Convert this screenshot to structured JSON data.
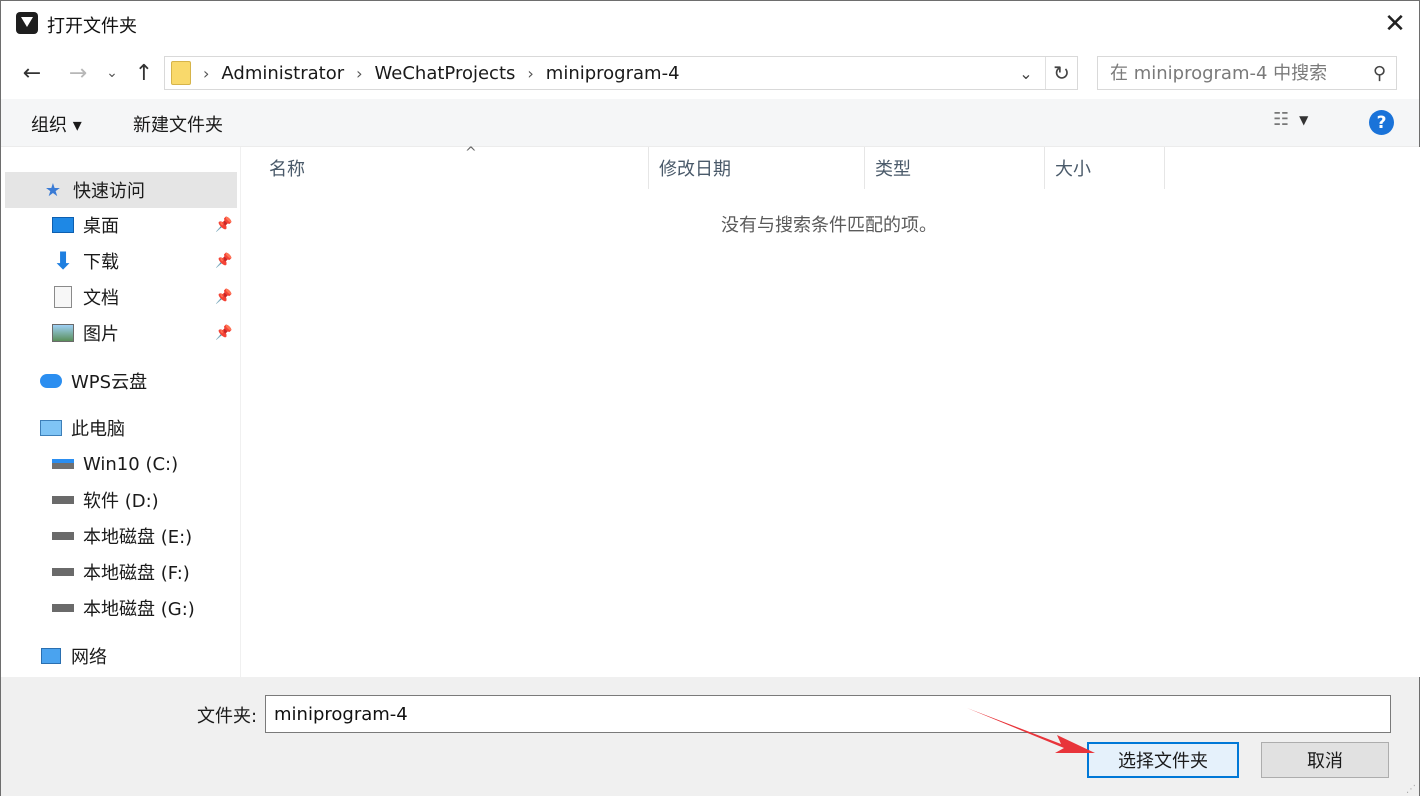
{
  "window": {
    "title": "打开文件夹"
  },
  "address": {
    "crumbs": [
      "Administrator",
      "WeChatProjects",
      "miniprogram-4"
    ]
  },
  "search": {
    "placeholder": "在 miniprogram-4 中搜索"
  },
  "toolbar": {
    "organize": "组织 ▾",
    "new_folder": "新建文件夹"
  },
  "sidebar": {
    "quick_access": "快速访问",
    "quick_items": [
      {
        "label": "桌面",
        "icon": "desktop-icon"
      },
      {
        "label": "下载",
        "icon": "download-icon"
      },
      {
        "label": "文档",
        "icon": "document-icon"
      },
      {
        "label": "图片",
        "icon": "pictures-icon"
      }
    ],
    "wps_cloud": "WPS云盘",
    "this_pc": "此电脑",
    "drives": [
      {
        "label": "Win10 (C:)",
        "icon": "windows-drive-icon"
      },
      {
        "label": "软件 (D:)",
        "icon": "drive-icon"
      },
      {
        "label": "本地磁盘 (E:)",
        "icon": "drive-icon"
      },
      {
        "label": "本地磁盘 (F:)",
        "icon": "drive-icon"
      },
      {
        "label": "本地磁盘 (G:)",
        "icon": "drive-icon"
      }
    ],
    "network": "网络"
  },
  "columns": [
    "名称",
    "修改日期",
    "类型",
    "大小"
  ],
  "content": {
    "empty_message": "没有与搜索条件匹配的项。"
  },
  "footer": {
    "folder_label": "文件夹:",
    "folder_value": "miniprogram-4",
    "select_button": "选择文件夹",
    "cancel_button": "取消"
  },
  "colors": {
    "accent": "#0078d7",
    "help": "#1a73d9",
    "annotation_arrow": "#e8343a"
  }
}
